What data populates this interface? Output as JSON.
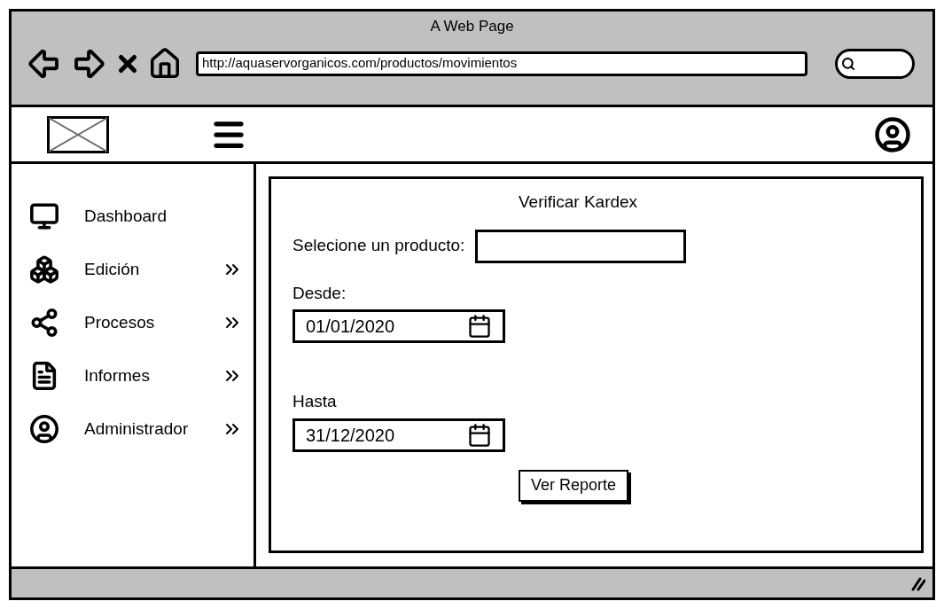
{
  "browser": {
    "title": "A Web Page",
    "url": "http://aquaservorganicos.com/productos/movimientos"
  },
  "sidebar": {
    "items": [
      {
        "label": "Dashboard",
        "submenu": false
      },
      {
        "label": "Edición",
        "submenu": true
      },
      {
        "label": "Procesos",
        "submenu": true
      },
      {
        "label": "Informes",
        "submenu": true
      },
      {
        "label": "Administrador",
        "submenu": true
      }
    ]
  },
  "form": {
    "title": "Verificar Kardex",
    "product_label": "Selecione un producto:",
    "from_label": "Desde:",
    "from_value": "01/01/2020",
    "to_label": "Hasta",
    "to_value": "31/12/2020",
    "button": "Ver Reporte"
  }
}
